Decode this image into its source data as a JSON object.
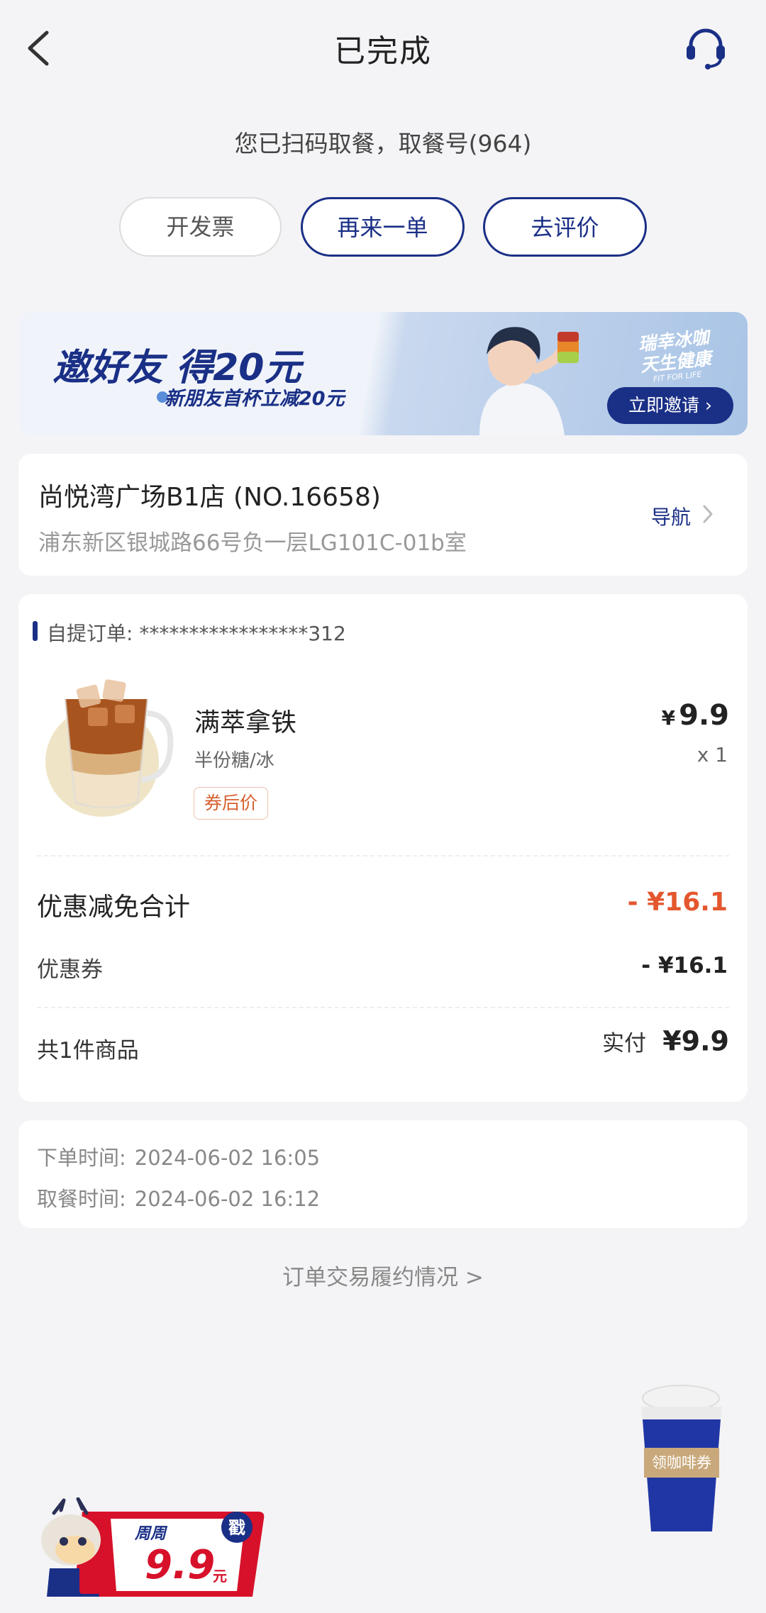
{
  "header": {
    "title": "已完成",
    "back_icon": "chevron-left-icon",
    "service_icon": "headset-icon"
  },
  "status": {
    "pickup_text": "您已扫码取餐，取餐号(964)"
  },
  "actions": {
    "invoice": "开发票",
    "reorder": "再来一单",
    "review": "去评价"
  },
  "banner": {
    "headline": "邀好友 得20元",
    "subline": "新朋友首杯立减20元",
    "slogan_line1": "瑞幸冰咖",
    "slogan_line2": "天生健康",
    "slogan_small": "FIT FOR LIFE",
    "button": "立即邀请"
  },
  "store": {
    "name": "尚悦湾广场B1店 (NO.16658)",
    "address": "浦东新区银城路66号负一层LG101C-01b室",
    "nav_label": "导航"
  },
  "order": {
    "number_label": "自提订单: *****************312",
    "item": {
      "name": "满萃拿铁",
      "spec": "半份糖/冰",
      "tag": "券后价",
      "currency": "¥",
      "price": "9.9",
      "qty": "x 1"
    },
    "discount_label": "优惠减免合计",
    "discount_total": "- ¥16.1",
    "coupon_label": "优惠券",
    "coupon_value": "- ¥16.1",
    "count_label": "共1件商品",
    "paid_label": "实付",
    "paid_value": "¥9.9"
  },
  "times": {
    "order_label": "下单时间:",
    "order_time": "2024-06-02 16:05",
    "pickup_label": "取餐时间:",
    "pickup_time": "2024-06-02 16:12"
  },
  "fulfillment_link": "订单交易履约情况 >",
  "floating": {
    "coupon_cup_label": "领咖啡券",
    "promo_week": "周周",
    "promo_price": "9.9",
    "promo_unit": "元",
    "promo_badge": "戳"
  },
  "colors": {
    "brand": "#1a2f86",
    "discount": "#e4572e",
    "background": "#f4f4f6"
  }
}
